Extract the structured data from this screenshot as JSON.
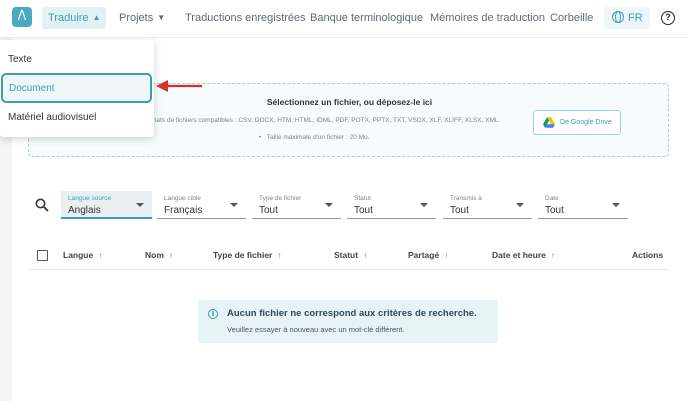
{
  "nav": {
    "logo_glyph": "Λ",
    "items": [
      {
        "label": "Traduire",
        "active": true,
        "has_caret": true
      },
      {
        "label": "Projets",
        "active": false,
        "has_caret": true
      },
      {
        "label": "Traductions enregistrées",
        "active": false
      },
      {
        "label": "Banque terminologique",
        "active": false
      },
      {
        "label": "Mémoires de traduction",
        "active": false
      },
      {
        "label": "Corbeille",
        "active": false
      }
    ],
    "language": "FR",
    "help_glyph": "?"
  },
  "menu": {
    "items": [
      "Texte",
      "Document",
      "Matériel audiovisuel"
    ],
    "selected": "Document"
  },
  "dropzone": {
    "title": "Sélectionnez un fichier, ou déposez-le ici",
    "formats": "mats de fichiers compatibles : CSV, DOCX, HTM, HTML, IDML, PDF, POTX, PPTX, TXT, VSDX, XLF, XLIFF, XLSX, XML.",
    "max_size": "Taille maximale d'un fichier : 20 Mo.",
    "google_drive_label": "De Google Drive"
  },
  "filters": [
    {
      "label": "Langue source",
      "value": "Anglais",
      "active": true
    },
    {
      "label": "Langue cible",
      "value": "Français",
      "active": false
    },
    {
      "label": "Type de fichier",
      "value": "Tout",
      "active": false
    },
    {
      "label": "Statut",
      "value": "Tout",
      "active": false
    },
    {
      "label": "Transmis à",
      "value": "Tout",
      "active": false
    },
    {
      "label": "Date",
      "value": "Tout",
      "active": false
    }
  ],
  "table": {
    "columns": [
      "Langue",
      "Nom",
      "Type de fichier",
      "Statut",
      "Partagé",
      "Date et heure",
      "Actions"
    ],
    "sort_glyph": "↑"
  },
  "empty_state": {
    "title": "Aucun fichier ne correspond aux critères de recherche.",
    "subtitle": "Veuillez essayer à nouveau avec un mot-clé différent.",
    "icon_glyph": "i"
  },
  "colors": {
    "accent": "#3d9cb5",
    "active_bg": "#e2f1f4",
    "arrow": "#d32f2f"
  }
}
